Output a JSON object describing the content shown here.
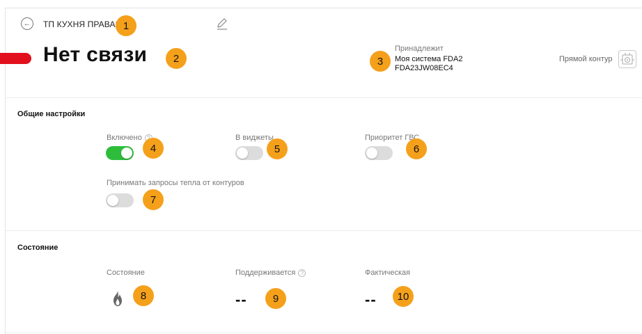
{
  "header": {
    "device_name": "ТП КУХНЯ ПРАВАЯ",
    "status_text": "Нет связи",
    "status_color": "#e2101d",
    "owner_label": "Принадлежит",
    "owner_system": "Моя система FDA2",
    "owner_serial": "FDA23JW08EC4",
    "circuit_label": "Прямой контур",
    "icons": {
      "back": "arrow-left-icon",
      "edit": "pencil-icon",
      "circuit": "pump-icon"
    }
  },
  "general": {
    "title": "Общие настройки",
    "settings": [
      {
        "label": "Включено",
        "on": true,
        "has_info": true
      },
      {
        "label": "В виджеты",
        "on": false,
        "has_info": false
      },
      {
        "label": "Приоритет ГВС",
        "on": false,
        "has_info": false
      },
      {
        "label": "Принимать запросы тепла от контуров",
        "on": false,
        "has_info": false
      }
    ]
  },
  "state": {
    "title": "Состояние",
    "state_label": "Состояние",
    "state_icon": "flame-icon",
    "supported_label": "Поддерживается",
    "supported_value": "--",
    "actual_label": "Фактическая",
    "actual_value": "--"
  },
  "colors": {
    "accent_on": "#2ebd3b",
    "toggle_off": "#dcdcdc",
    "badge": "#f5a01b"
  },
  "badges": [
    "1",
    "2",
    "3",
    "4",
    "5",
    "6",
    "7",
    "8",
    "9",
    "10"
  ]
}
